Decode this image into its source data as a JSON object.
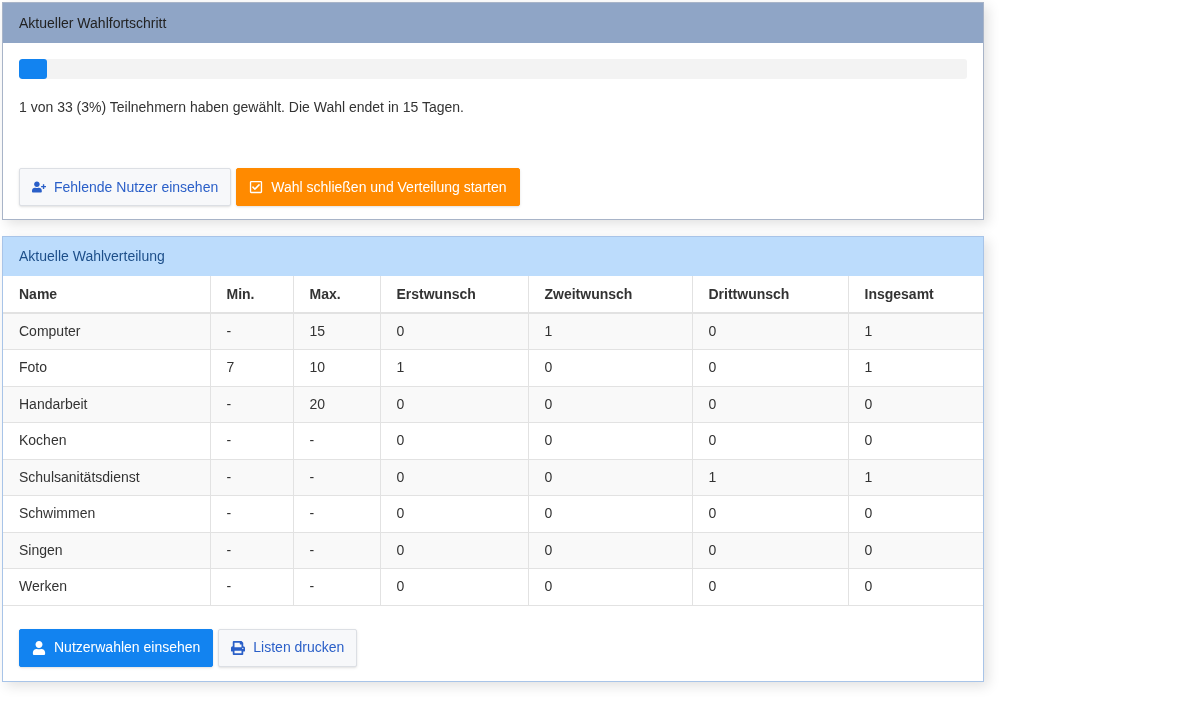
{
  "progress_panel": {
    "title": "Aktueller Wahlfortschritt",
    "progress": {
      "level": 0.03
    },
    "summary": "1 von 33 (3%) Teilnehmern haben gewählt. Die Wahl endet in 15 Tagen.",
    "buttons": [
      {
        "label": "Fehlende Nutzer einsehen"
      },
      {
        "label": "Wahl schließen und Verteilung starten"
      }
    ]
  },
  "distribution_panel": {
    "title": "Aktuelle Wahlverteilung",
    "table": {
      "columns": [
        "Name",
        "Min.",
        "Max.",
        "Erstwunsch",
        "Zweitwunsch",
        "Drittwunsch",
        "Insgesamt"
      ],
      "rows": [
        [
          "Computer",
          "-",
          "15",
          "0",
          "1",
          "0",
          "1"
        ],
        [
          "Foto",
          "7",
          "10",
          "1",
          "0",
          "0",
          "1"
        ],
        [
          "Handarbeit",
          "-",
          "20",
          "0",
          "0",
          "0",
          "0"
        ],
        [
          "Kochen",
          "-",
          "-",
          "0",
          "0",
          "0",
          "0"
        ],
        [
          "Schulsanitätsdienst",
          "-",
          "-",
          "0",
          "0",
          "1",
          "1"
        ],
        [
          "Schwimmen",
          "-",
          "-",
          "0",
          "0",
          "0",
          "0"
        ],
        [
          "Singen",
          "-",
          "-",
          "0",
          "0",
          "0",
          "0"
        ],
        [
          "Werken",
          "-",
          "-",
          "0",
          "0",
          "0",
          "0"
        ]
      ]
    },
    "buttons": [
      {
        "label": "Nutzerwahlen einsehen"
      },
      {
        "label": "Listen drucken"
      }
    ]
  }
}
